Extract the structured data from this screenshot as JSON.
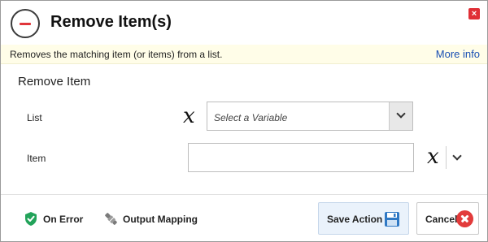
{
  "dialog": {
    "title": "Remove Item(s)",
    "description": "Removes the matching item (or items) from a list.",
    "more_info": "More info",
    "close_symbol": "×"
  },
  "section": {
    "title": "Remove Item"
  },
  "fields": {
    "list": {
      "label": "List",
      "variable_symbol": "x",
      "placeholder": "Select a Variable",
      "value": ""
    },
    "item": {
      "label": "Item",
      "variable_symbol": "x",
      "value": ""
    }
  },
  "footer": {
    "on_error": "On Error",
    "output_mapping": "Output Mapping",
    "save_label": "Save Action",
    "cancel_label": "Cancel"
  },
  "icons": {
    "header": "remove-circle-icon",
    "close": "close-icon",
    "on_error": "shield-check-icon",
    "output_mapping": "plug-icon",
    "save": "floppy-disk-icon",
    "cancel": "cancel-x-icon",
    "dropdown": "chevron-down-icon"
  },
  "colors": {
    "accent_red": "#e0353a",
    "link_blue": "#1a4fb3",
    "info_bar_bg": "#fffde8",
    "shield_green": "#22a35a",
    "save_bg": "#eaf2fb",
    "save_icon_blue": "#2f78c4"
  }
}
